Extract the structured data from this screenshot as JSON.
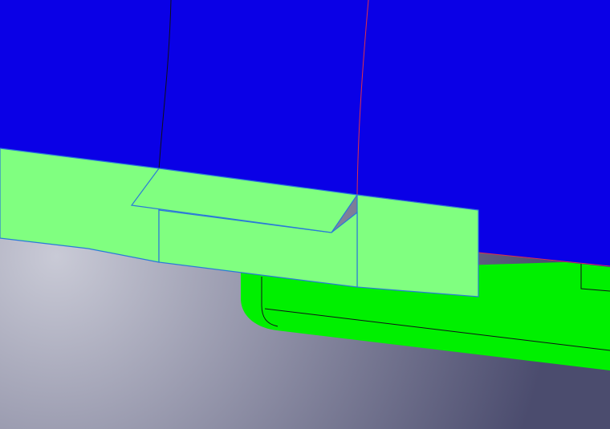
{
  "colors": {
    "background_top": "#c9cad6",
    "background_bottom": "#4b4c6e",
    "blue_body": "#0a00e6",
    "bright_green_body": "#00f000",
    "pale_green_faces": "#80ff80",
    "edge_blue": "#2a7ad8",
    "edge_dark": "#101018",
    "edge_red": "#e0304a"
  },
  "scene": {
    "objects": [
      "blue-surface-body",
      "green-rounded-base",
      "pale-green-band",
      "pale-green-tab-top",
      "pale-green-tab-front",
      "pale-green-side-plate"
    ]
  }
}
